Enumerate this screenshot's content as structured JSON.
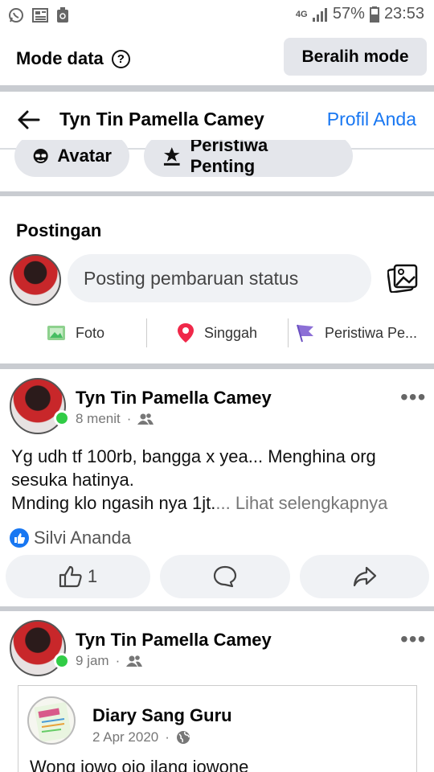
{
  "status_bar": {
    "network": "4G",
    "battery": "57%",
    "time": "23:53"
  },
  "data_mode": {
    "title": "Mode data",
    "help_icon": "?",
    "switch_label": "Beralih mode"
  },
  "profile_header": {
    "name": "Tyn Tin Pamella Camey",
    "profile_link": "Profil Anda"
  },
  "chips": [
    {
      "label": "Avatar",
      "icon": "avatar-icon"
    },
    {
      "label": "Peristiwa Penting",
      "icon": "life-event-icon"
    }
  ],
  "posting": {
    "title": "Postingan",
    "placeholder": "Posting pembaruan status",
    "actions": [
      {
        "label": "Foto",
        "icon": "photo-icon"
      },
      {
        "label": "Singgah",
        "icon": "location-pin-icon"
      },
      {
        "label": "Peristiwa Pe...",
        "icon": "flag-icon"
      }
    ]
  },
  "posts": [
    {
      "author": "Tyn Tin Pamella Camey",
      "time": "8 menit",
      "separator": "·",
      "text_line1": "Yg udh tf 100rb, bangga x yea... Menghina org sesuka hatinya.",
      "text_line2": "Mnding klo ngasih nya 1jt.",
      "see_more": "... Lihat selengkapnya",
      "reaction_name": "Silvi Ananda",
      "like_count": "1"
    },
    {
      "author": "Tyn Tin Pamella Camey",
      "time": "9 jam",
      "separator": "·",
      "shared": {
        "author": "Diary Sang Guru",
        "date": "2 Apr 2020",
        "text": "Wong jowo ojo ilang jowone"
      }
    }
  ],
  "colors": {
    "accent": "#1877f2",
    "online": "#31cc46",
    "chip_bg": "#e4e6eb",
    "divider": "#c9ccd1"
  }
}
